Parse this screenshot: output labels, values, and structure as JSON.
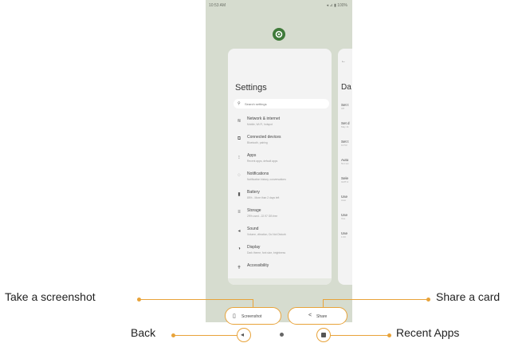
{
  "status_bar": {
    "time": "10:53 AM",
    "icons": "◂ ⊿ ▮ 100%"
  },
  "settings_card": {
    "title": "Settings",
    "search_placeholder": "Search settings",
    "items": [
      {
        "icon": "wifi-icon",
        "glyph": "≋",
        "label": "Network & internet",
        "sub": "Mobile, Wi-Fi, hotspot"
      },
      {
        "icon": "devices-icon",
        "glyph": "⧉",
        "label": "Connected devices",
        "sub": "Bluetooth, pairing"
      },
      {
        "icon": "apps-icon",
        "glyph": "⁝",
        "label": "Apps",
        "sub": "Recent apps, default apps"
      },
      {
        "icon": "bell-icon",
        "glyph": "◌",
        "label": "Notifications",
        "sub": "Notification history, conversations"
      },
      {
        "icon": "battery-icon",
        "glyph": "▮",
        "label": "Battery",
        "sub": "85% - More than 2 days left"
      },
      {
        "icon": "storage-icon",
        "glyph": "≡",
        "label": "Storage",
        "sub": "29% used - 22.97 GB free"
      },
      {
        "icon": "sound-icon",
        "glyph": "◂",
        "label": "Sound",
        "sub": "Volume, vibration, Do Not Disturb"
      },
      {
        "icon": "display-icon",
        "glyph": "◑",
        "label": "Display",
        "sub": "Dark theme, font size, brightness"
      },
      {
        "icon": "accessibility-icon",
        "glyph": "✝",
        "label": "Accessibility",
        "sub": ""
      }
    ]
  },
  "peek_card": {
    "back_glyph": "←",
    "title": "Da",
    "rows": [
      {
        "a": "Set t",
        "b": "Off"
      },
      {
        "a": "Set d",
        "b": "May 11"
      },
      {
        "a": "Set t",
        "b": "10:53"
      },
      {
        "a": "Auto",
        "b": "Not set"
      },
      {
        "a": "Sele",
        "b": "GMT-0"
      },
      {
        "a": "Use",
        "b": "Auto"
      },
      {
        "a": "Use",
        "b": "Use"
      },
      {
        "a": "Use",
        "b": "1:00"
      }
    ]
  },
  "actions": {
    "screenshot_icon": "▯",
    "screenshot_label": "Screenshot",
    "share_icon": "<",
    "share_label": "Share"
  },
  "nav": {
    "back_glyph": "◂"
  },
  "callouts": {
    "screenshot": "Take a screenshot",
    "back": "Back",
    "share": "Share a card",
    "recent": "Recent Apps"
  },
  "colors": {
    "accent": "#e8a33a",
    "phone_bg": "#d6dccf",
    "app_icon": "#3f7a3a"
  }
}
